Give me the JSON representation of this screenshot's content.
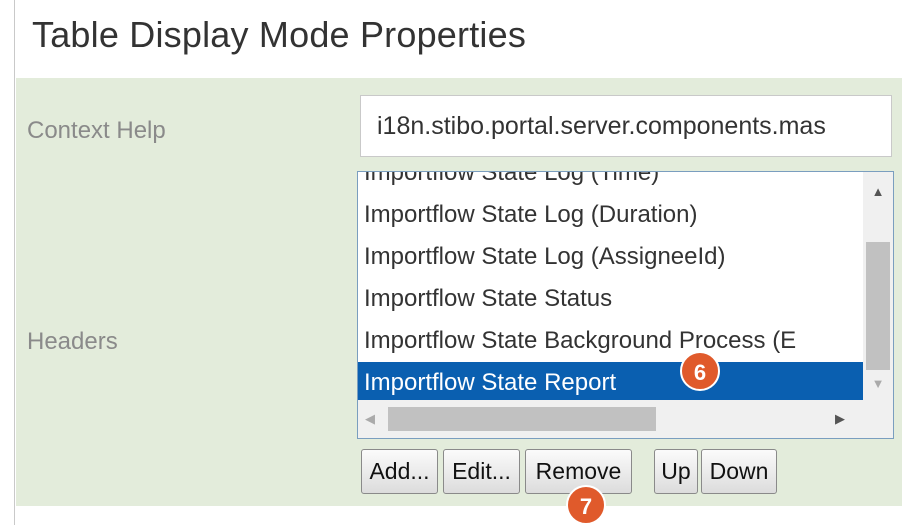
{
  "dialog": {
    "title": "Table Display Mode Properties"
  },
  "context_help": {
    "label": "Context Help",
    "value": "i18n.stibo.portal.server.components.mas"
  },
  "headers": {
    "label": "Headers",
    "items": [
      "Importflow State Log (Time)",
      "Importflow State Log (Duration)",
      "Importflow State Log (AssigneeId)",
      "Importflow State Status",
      "Importflow State Background Process (E",
      "Importflow State Report"
    ],
    "selected_index": 5
  },
  "buttons": {
    "add": "Add...",
    "edit": "Edit...",
    "remove": "Remove",
    "up": "Up",
    "down": "Down"
  },
  "callouts": {
    "six": "6",
    "seven": "7"
  },
  "colors": {
    "panel": "#e3ecdb",
    "selection": "#0a5fb0",
    "callout": "#e05a2b"
  }
}
